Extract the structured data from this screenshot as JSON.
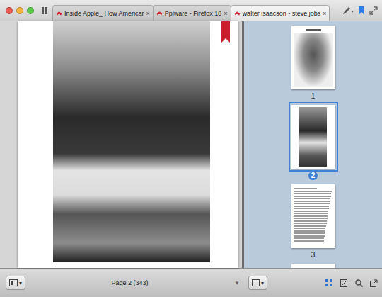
{
  "window": {
    "tabs": [
      {
        "label": "Inside Apple_ How Americar",
        "close": "×",
        "selected": false
      },
      {
        "label": "Pplware - Firefox 18",
        "close": "×",
        "selected": false
      },
      {
        "label": "walter isaacson - steve jobs",
        "close": "×",
        "selected": true
      }
    ]
  },
  "document": {
    "page_indicator": "Page 2 (343)",
    "bookmarked": true
  },
  "sidebar": {
    "thumbnails": [
      {
        "label": "1",
        "kind": "portrait",
        "selected": false
      },
      {
        "label": "2",
        "kind": "photo",
        "selected": true
      },
      {
        "label": "3",
        "kind": "text",
        "selected": false
      },
      {
        "label": "",
        "kind": "partial",
        "selected": false
      }
    ]
  },
  "status_bar": {
    "menu_arrow": "▾",
    "page_arrow": "▼",
    "zoom_arrow": "▾"
  }
}
